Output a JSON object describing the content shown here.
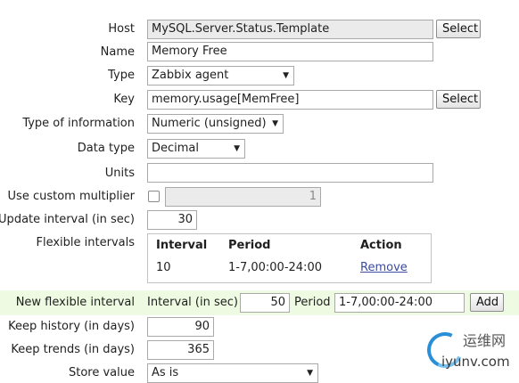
{
  "form": {
    "host": {
      "label": "Host",
      "value": "MySQL.Server.Status.Template",
      "button": "Select"
    },
    "name": {
      "label": "Name",
      "value": "Memory Free"
    },
    "type": {
      "label": "Type",
      "value": "Zabbix agent"
    },
    "key": {
      "label": "Key",
      "value": "memory.usage[MemFree]",
      "button": "Select"
    },
    "type_of_information": {
      "label": "Type of information",
      "value": "Numeric (unsigned)"
    },
    "data_type": {
      "label": "Data type",
      "value": "Decimal"
    },
    "units": {
      "label": "Units",
      "value": ""
    },
    "custom_multiplier": {
      "label": "Use custom multiplier",
      "checked": false,
      "value": "1"
    },
    "update_interval": {
      "label": "Update interval (in sec)",
      "value": "30"
    },
    "flexible_intervals": {
      "label": "Flexible intervals",
      "columns": [
        "Interval",
        "Period",
        "Action"
      ],
      "rows": [
        {
          "interval": "10",
          "period": "1-7,00:00-24:00",
          "action": "Remove"
        }
      ]
    },
    "new_flexible_interval": {
      "label": "New flexible interval",
      "interval_label": "Interval (in sec)",
      "interval_value": "50",
      "period_label": "Period",
      "period_value": "1-7,00:00-24:00",
      "button": "Add"
    },
    "keep_history": {
      "label": "Keep history (in days)",
      "value": "90"
    },
    "keep_trends": {
      "label": "Keep trends (in days)",
      "value": "365"
    },
    "store_value": {
      "label": "Store value",
      "value": "As is"
    }
  },
  "watermark": {
    "cn": "运维网",
    "url": "iyunv.com"
  },
  "colors": {
    "band": "#eefbe2",
    "link": "#3c4b9e",
    "readonly": "#ebebeb"
  }
}
